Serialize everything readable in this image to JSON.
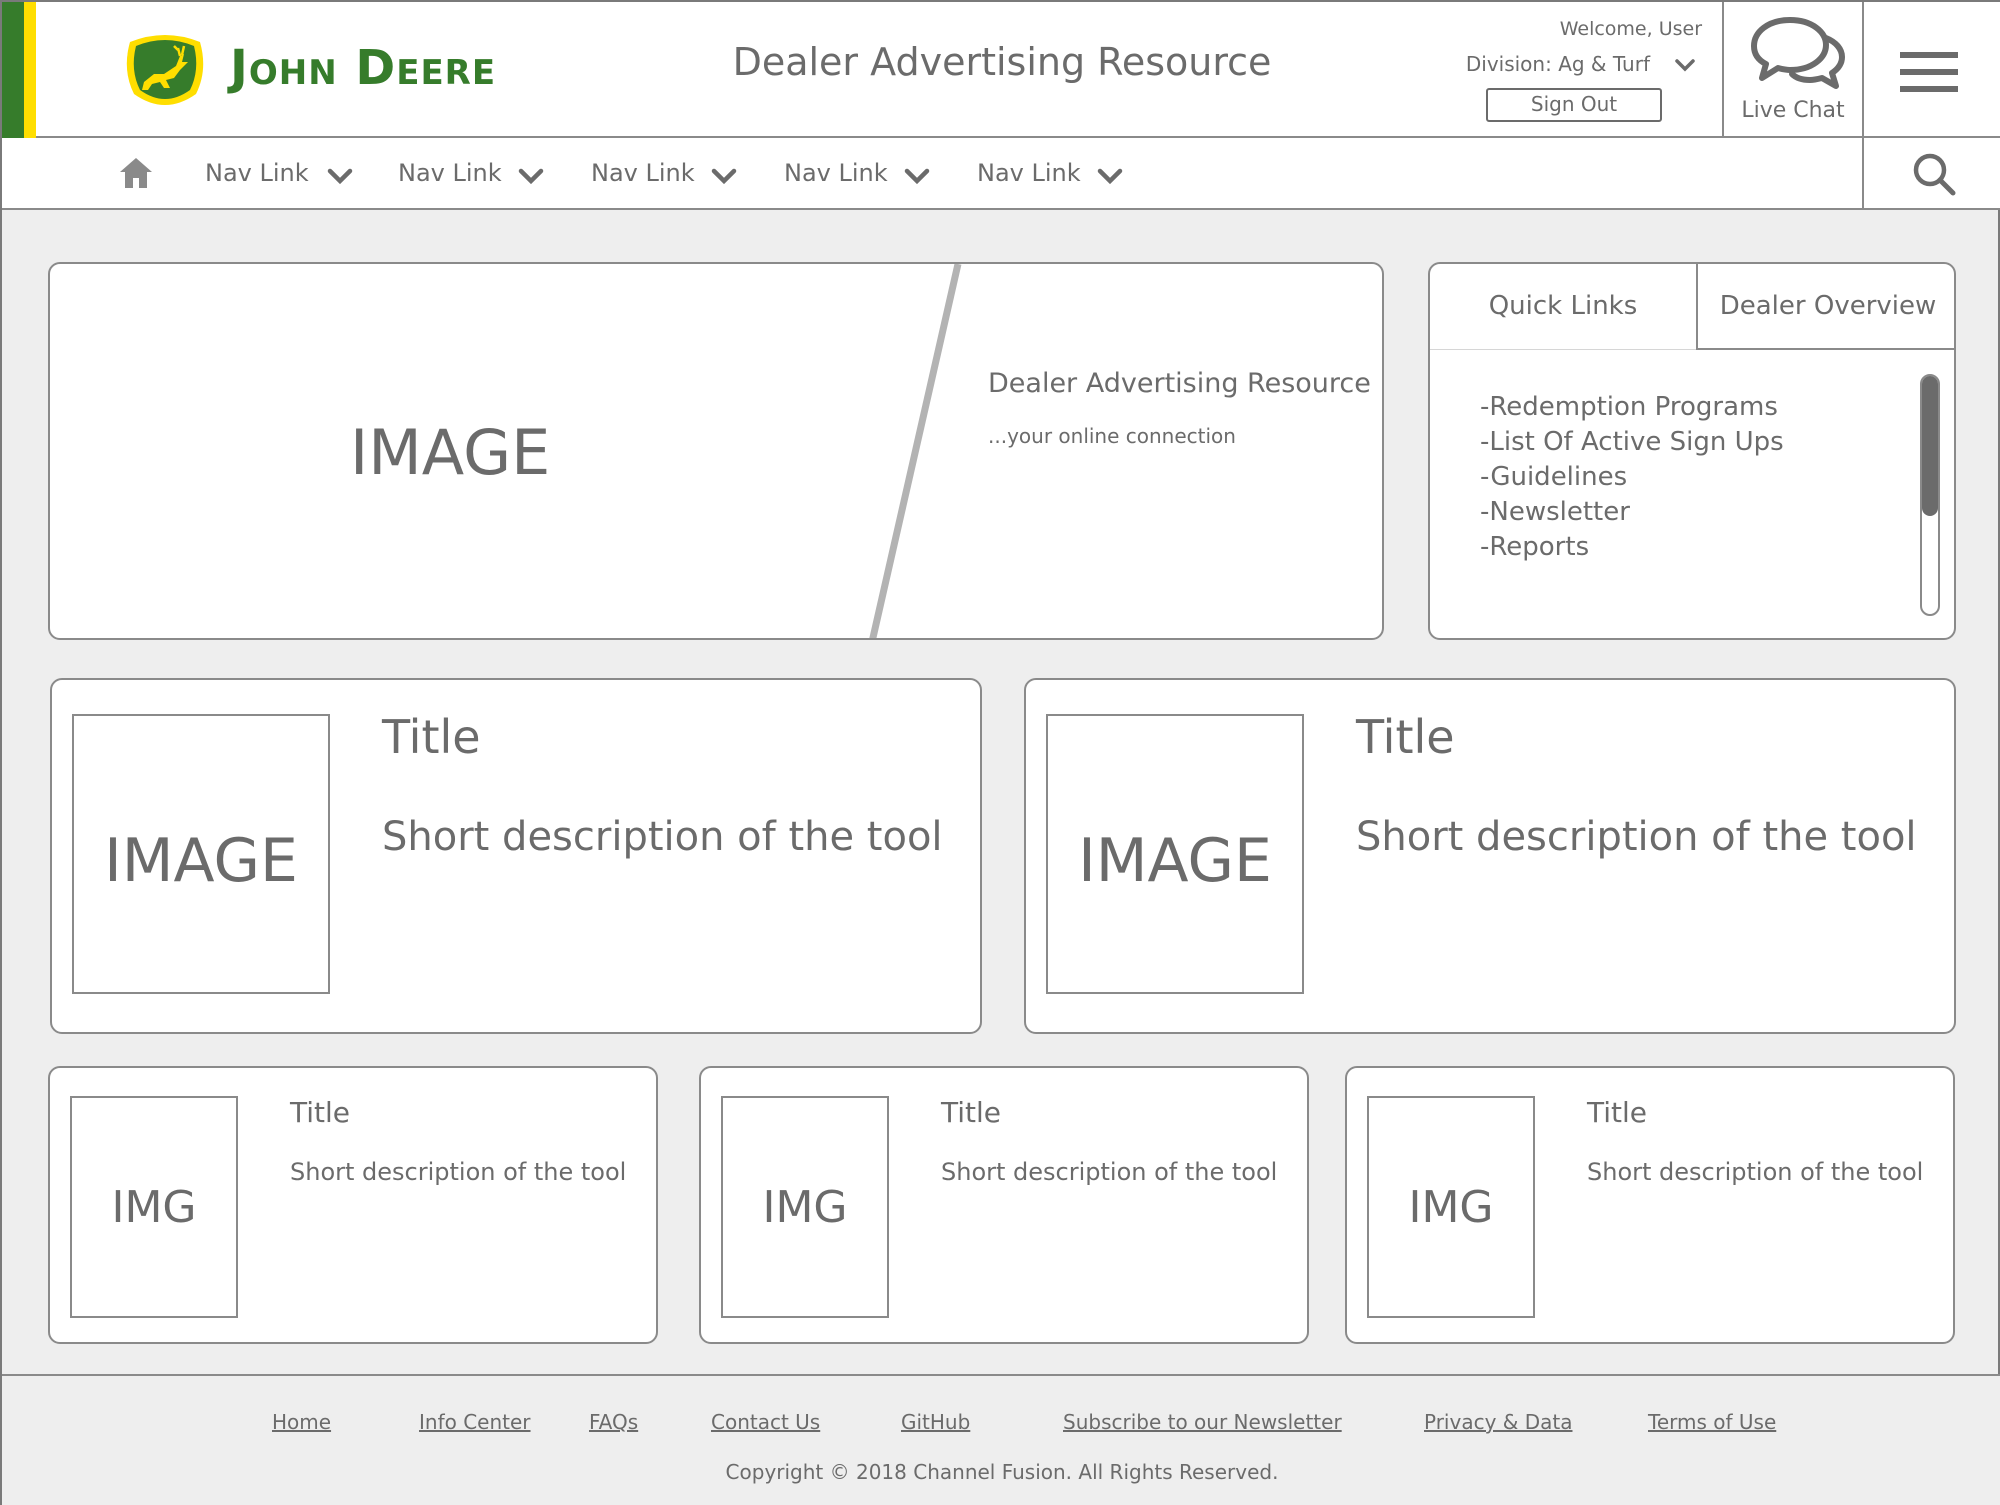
{
  "colors": {
    "brand_green": "#367c2b",
    "brand_yellow": "#ffde00",
    "text_gray": "#6b6b6b",
    "border_gray": "#8a8a8a",
    "page_background": "#eeeeee"
  },
  "header": {
    "logo": {
      "brand": "John Deere",
      "icon": "leaping-deer-icon"
    },
    "site_title": "Dealer Advertising Resource",
    "welcome": "Welcome, User",
    "division": "Division: Ag & Turf",
    "sign_out_label": "Sign Out",
    "live_chat_label": "Live Chat"
  },
  "nav": {
    "home_icon": "home-icon",
    "items": [
      {
        "label": "Nav Link"
      },
      {
        "label": "Nav Link"
      },
      {
        "label": "Nav Link"
      },
      {
        "label": "Nav Link"
      },
      {
        "label": "Nav Link"
      }
    ],
    "search_icon": "search-icon"
  },
  "hero": {
    "image_placeholder": "IMAGE",
    "title": "Dealer Advertising Resource",
    "subtitle": "...your online connection"
  },
  "panel": {
    "tabs": [
      "Quick Links",
      "Dealer Overview"
    ],
    "quick_links": [
      "-Redemption Programs",
      "-List Of Active Sign Ups",
      "-Guidelines",
      "-Newsletter",
      "-Reports"
    ],
    "scroll_position": 0
  },
  "features": [
    {
      "image": "IMAGE",
      "title": "Title",
      "description": "Short description of the tool"
    },
    {
      "image": "IMAGE",
      "title": "Title",
      "description": "Short description of the tool"
    }
  ],
  "tools": [
    {
      "image": "IMG",
      "title": "Title",
      "description": "Short description of the tool"
    },
    {
      "image": "IMG",
      "title": "Title",
      "description": "Short description of the tool"
    },
    {
      "image": "IMG",
      "title": "Title",
      "description": "Short description of the tool"
    }
  ],
  "footer": {
    "links": [
      "Home",
      "Info Center",
      "FAQs",
      "Contact Us",
      "GitHub",
      "Subscribe to our Newsletter",
      "Privacy & Data",
      "Terms of Use"
    ],
    "copyright": "Copyright © 2018 Channel Fusion. All Rights Reserved."
  }
}
